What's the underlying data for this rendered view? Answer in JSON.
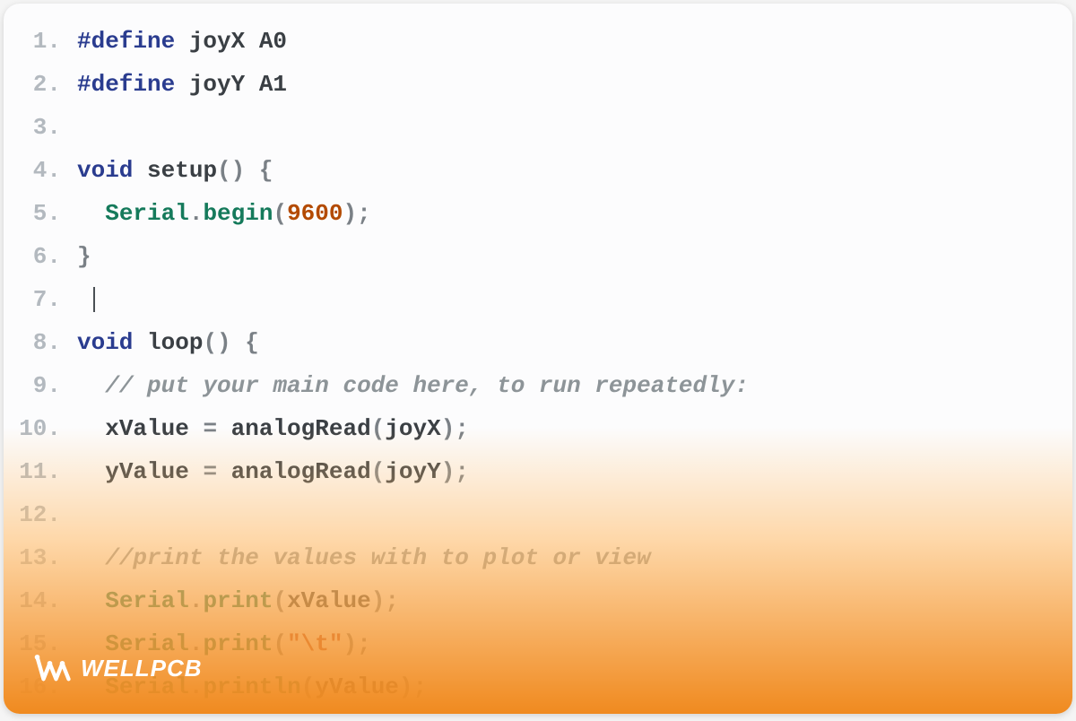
{
  "watermark": {
    "text": "WELLPCB"
  },
  "code": {
    "lines": [
      {
        "n": "1.",
        "tokens": [
          {
            "t": "#define",
            "c": "kw"
          },
          {
            "t": " joyX A0",
            "c": "fn"
          }
        ]
      },
      {
        "n": "2.",
        "tokens": [
          {
            "t": "#define",
            "c": "kw"
          },
          {
            "t": " joyY A1",
            "c": "fn"
          }
        ]
      },
      {
        "n": "3.",
        "tokens": []
      },
      {
        "n": "4.",
        "tokens": [
          {
            "t": "void",
            "c": "kw"
          },
          {
            "t": " ",
            "c": "fn"
          },
          {
            "t": "setup",
            "c": "fn"
          },
          {
            "t": "()",
            "c": "pun"
          },
          {
            "t": " ",
            "c": "fn"
          },
          {
            "t": "{",
            "c": "pun"
          }
        ]
      },
      {
        "n": "5.",
        "indent": "  ",
        "tokens": [
          {
            "t": "Serial",
            "c": "cls"
          },
          {
            "t": ".",
            "c": "pun"
          },
          {
            "t": "begin",
            "c": "mth"
          },
          {
            "t": "(",
            "c": "pun"
          },
          {
            "t": "9600",
            "c": "num"
          },
          {
            "t": ")",
            "c": "pun"
          },
          {
            "t": ";",
            "c": "pun"
          }
        ]
      },
      {
        "n": "6.",
        "tokens": [
          {
            "t": "}",
            "c": "pun"
          }
        ]
      },
      {
        "n": "7.",
        "indent": " ",
        "cursor": true,
        "tokens": []
      },
      {
        "n": "8.",
        "tokens": [
          {
            "t": "void",
            "c": "kw"
          },
          {
            "t": " ",
            "c": "fn"
          },
          {
            "t": "loop",
            "c": "fn"
          },
          {
            "t": "()",
            "c": "pun"
          },
          {
            "t": " ",
            "c": "fn"
          },
          {
            "t": "{",
            "c": "pun"
          }
        ]
      },
      {
        "n": "9.",
        "indent": "  ",
        "tokens": [
          {
            "t": "// put your main code here, to run repeatedly:",
            "c": "cmt"
          }
        ]
      },
      {
        "n": "10.",
        "indent": "  ",
        "tokens": [
          {
            "t": "xValue ",
            "c": "fn"
          },
          {
            "t": "=",
            "c": "pun"
          },
          {
            "t": " analogRead",
            "c": "fn"
          },
          {
            "t": "(",
            "c": "pun"
          },
          {
            "t": "joyX",
            "c": "fn"
          },
          {
            "t": ")",
            "c": "pun"
          },
          {
            "t": ";",
            "c": "pun"
          }
        ]
      },
      {
        "n": "11.",
        "indent": "  ",
        "tokens": [
          {
            "t": "yValue ",
            "c": "fn"
          },
          {
            "t": "=",
            "c": "pun"
          },
          {
            "t": " analogRead",
            "c": "fn"
          },
          {
            "t": "(",
            "c": "pun"
          },
          {
            "t": "joyY",
            "c": "fn"
          },
          {
            "t": ")",
            "c": "pun"
          },
          {
            "t": ";",
            "c": "pun"
          }
        ]
      },
      {
        "n": "12.",
        "tokens": []
      },
      {
        "n": "13.",
        "indent": "  ",
        "tokens": [
          {
            "t": "//print the values with to plot or view",
            "c": "cmt"
          }
        ]
      },
      {
        "n": "14.",
        "indent": "  ",
        "tokens": [
          {
            "t": "Serial",
            "c": "cls"
          },
          {
            "t": ".",
            "c": "pun"
          },
          {
            "t": "print",
            "c": "mth"
          },
          {
            "t": "(",
            "c": "pun"
          },
          {
            "t": "xValue",
            "c": "fn"
          },
          {
            "t": ")",
            "c": "pun"
          },
          {
            "t": ";",
            "c": "pun"
          }
        ]
      },
      {
        "n": "15.",
        "indent": "  ",
        "tokens": [
          {
            "t": "Serial",
            "c": "cls"
          },
          {
            "t": ".",
            "c": "pun"
          },
          {
            "t": "print",
            "c": "mth"
          },
          {
            "t": "(",
            "c": "pun"
          },
          {
            "t": "\"\\t\"",
            "c": "str"
          },
          {
            "t": ")",
            "c": "pun"
          },
          {
            "t": ";",
            "c": "pun"
          }
        ]
      },
      {
        "n": "16.",
        "indent": "  ",
        "tokens": [
          {
            "t": "Serial",
            "c": "cls"
          },
          {
            "t": ".",
            "c": "pun"
          },
          {
            "t": "println",
            "c": "mth"
          },
          {
            "t": "(",
            "c": "pun"
          },
          {
            "t": "yValue",
            "c": "fn"
          },
          {
            "t": ")",
            "c": "pun"
          },
          {
            "t": ";",
            "c": "pun"
          }
        ]
      }
    ]
  }
}
